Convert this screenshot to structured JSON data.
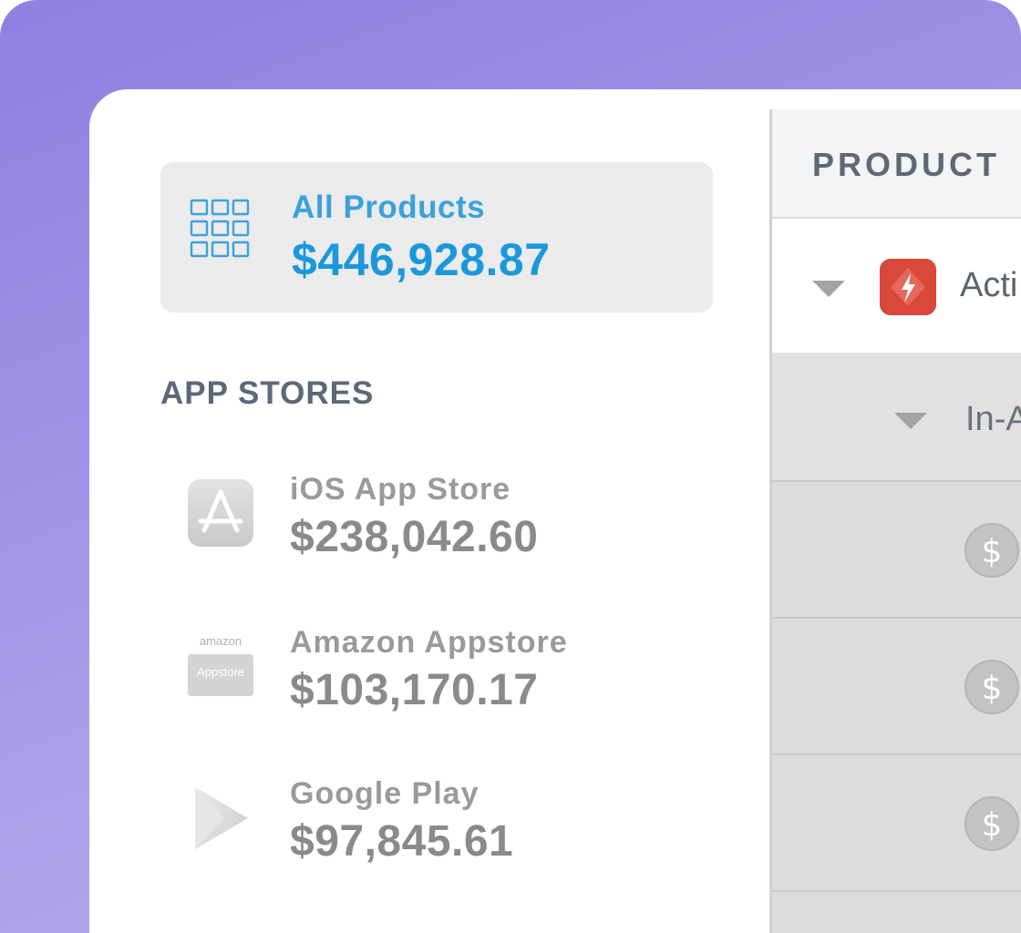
{
  "sidebar": {
    "all_products": {
      "label": "All Products",
      "amount": "$446,928.87",
      "icon": "grid-icon",
      "color": "#1a98db"
    },
    "section_heading": "APP STORES",
    "stores": [
      {
        "name": "iOS App Store",
        "amount": "$238,042.60",
        "icon": "app-store-icon"
      },
      {
        "name": "Amazon Appstore",
        "amount": "$103,170.17",
        "icon": "amazon-appstore-icon",
        "logo_text": [
          "amazon",
          "Appstore"
        ]
      },
      {
        "name": "Google Play",
        "amount": "$97,845.61",
        "icon": "google-play-icon"
      }
    ]
  },
  "table": {
    "header": "PRODUCT",
    "rows": [
      {
        "type": "product",
        "text": "Acti",
        "icon": "lightning-app-icon",
        "icon_color": "#d8493b"
      },
      {
        "type": "group",
        "text": "In-A"
      },
      {
        "type": "item",
        "icon": "dollar-icon"
      },
      {
        "type": "item",
        "icon": "dollar-icon"
      },
      {
        "type": "item",
        "icon": "dollar-icon"
      }
    ]
  }
}
